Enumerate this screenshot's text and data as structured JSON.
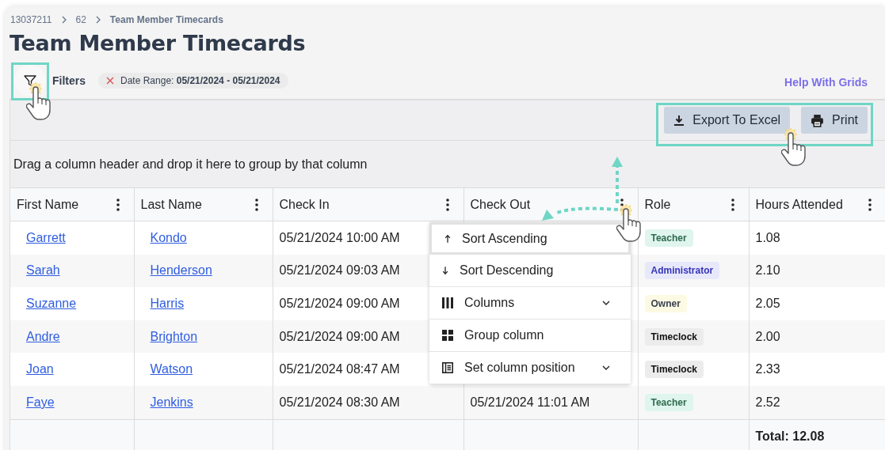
{
  "breadcrumb": [
    {
      "label": "13037211",
      "current": false
    },
    {
      "label": "62",
      "current": false
    },
    {
      "label": "Team Member Timecards",
      "current": true
    }
  ],
  "title": "Team Member Timecards",
  "filters": {
    "label": "Filters",
    "chips": [
      {
        "text": "Date Range: **05/21/2024 - 05/21/2024**"
      }
    ]
  },
  "help_link": "Help With Grids",
  "toolbar": {
    "buttons": [
      {
        "label": "Export To Excel",
        "kind": "export"
      },
      {
        "label": "Print",
        "kind": "print"
      }
    ]
  },
  "group_panel": "Drag a column header and drop it here to group by that column",
  "table": {
    "columns": [
      "First Name",
      "Last Name",
      "Check In",
      "Check Out",
      "Role",
      "Hours Attended"
    ],
    "rows": [
      {
        "first_name": "Garrett",
        "last_name": "Kondo",
        "check_in": "05/21/2024 10:00 AM",
        "role": "Teacher",
        "color": "#dff5ee",
        "hours": "1.08"
      },
      {
        "first_name": "Sarah",
        "last_name": "Henderson",
        "check_in": "05/21/2024 09:03 AM",
        "role": "Administrator",
        "color": "#e8e8fb",
        "hours": "2.10"
      },
      {
        "first_name": "Suzanne",
        "last_name": "Harris",
        "check_in": "05/21/2024 09:00 AM",
        "role": "Owner",
        "color": "#fdfae3",
        "hours": "2.05"
      },
      {
        "first_name": "Andre",
        "last_name": "Brighton",
        "check_in": "05/21/2024 09:00 AM",
        "role": "Timeclock",
        "color": "#ececec",
        "hours": "2.00"
      },
      {
        "first_name": "Joan",
        "last_name": "Watson",
        "check_in": "05/21/2024 08:47 AM",
        "role": "Timeclock",
        "color": "#ececec",
        "hours": "2.33"
      },
      {
        "first_name": "Faye",
        "last_name": "Jenkins",
        "check_in": "05/21/2024 08:30 AM",
        "check_out": "05/21/2024 11:01 AM",
        "role": "Teacher",
        "color": "#dff5ee",
        "hours": "2.52"
      }
    ],
    "footer": {
      "hours": "Total: 12.08"
    }
  },
  "column_menu": {
    "items": [
      {
        "label": "Sort Ascending",
        "kind": "up",
        "selected": true,
        "submenu": false
      },
      {
        "label": "Sort Descending",
        "kind": "down",
        "selected": false,
        "submenu": false
      },
      {
        "label": "Columns",
        "kind": "columns",
        "selected": false,
        "submenu": true
      },
      {
        "label": "Group column",
        "kind": "grid",
        "selected": false,
        "submenu": false
      },
      {
        "label": "Set column position",
        "kind": "list",
        "selected": false,
        "submenu": true
      }
    ]
  }
}
